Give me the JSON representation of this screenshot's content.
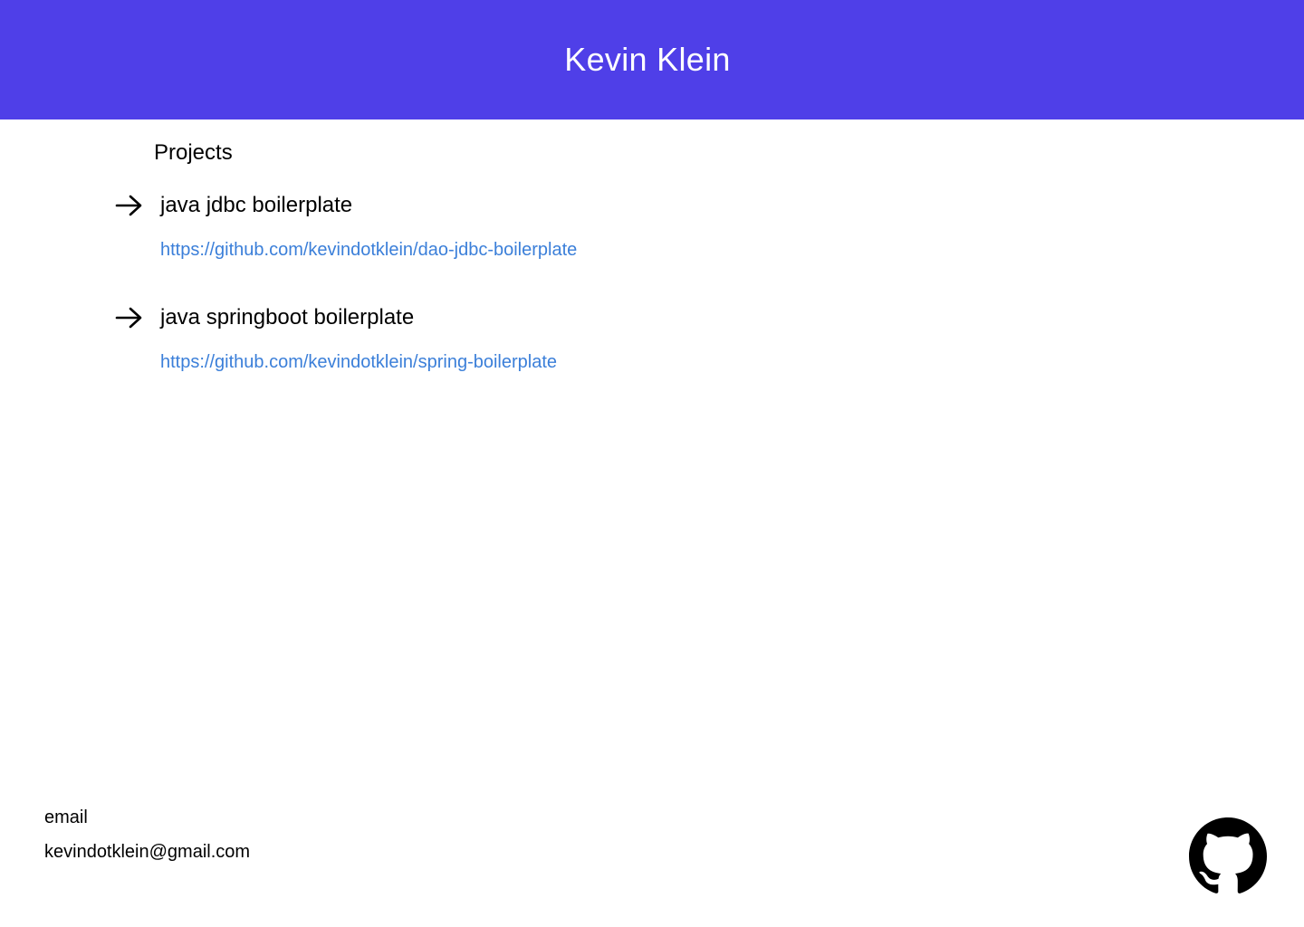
{
  "header": {
    "title": "Kevin Klein",
    "background_color": "#4f3fe8"
  },
  "projects_section": {
    "heading": "Projects",
    "items": [
      {
        "icon": "arrow-right-icon",
        "title": "java jdbc boilerplate",
        "url": "https://github.com/kevindotklein/dao-jdbc-boilerplate"
      },
      {
        "icon": "arrow-right-icon",
        "title": "java springboot boilerplate",
        "url": "https://github.com/kevindotklein/spring-boilerplate"
      }
    ]
  },
  "footer": {
    "email_label": "email",
    "email_value": "kevindotklein@gmail.com",
    "github_icon": "github-icon"
  },
  "colors": {
    "link": "#3b7fd9",
    "text": "#000000",
    "header_text": "#ffffff"
  }
}
